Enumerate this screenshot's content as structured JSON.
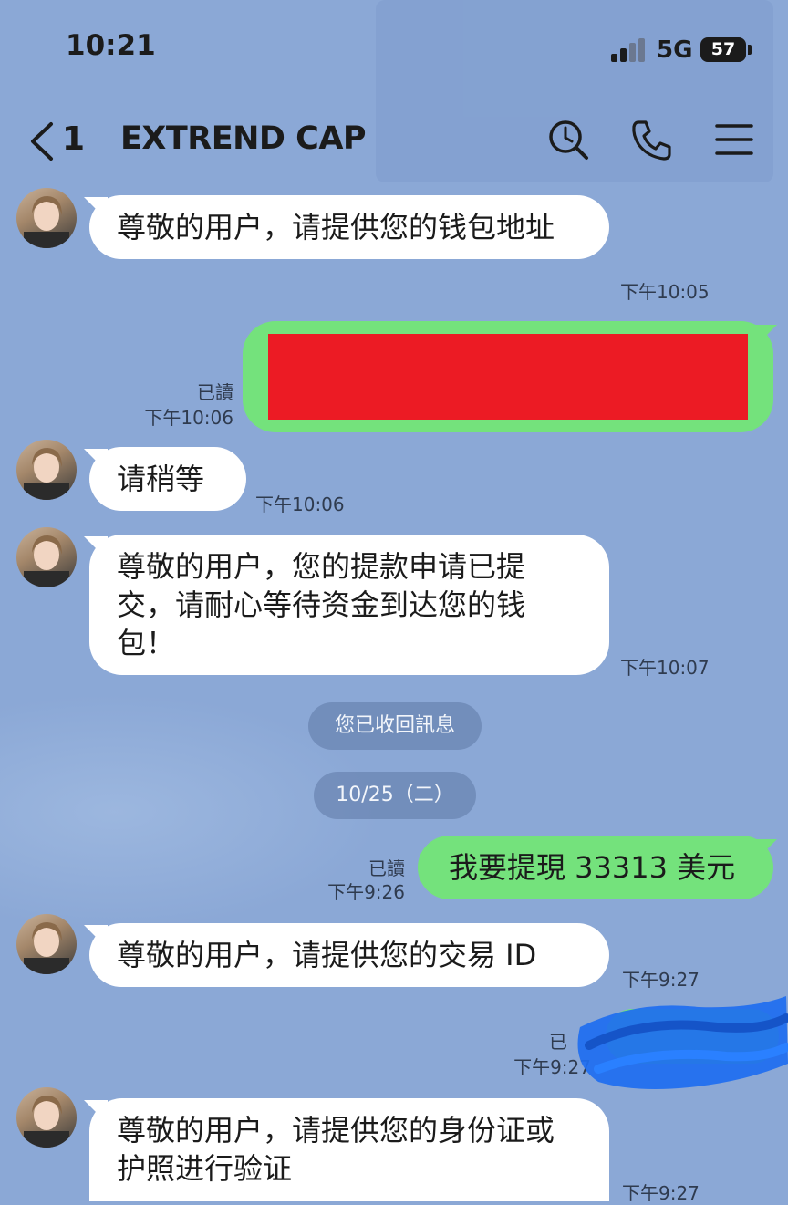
{
  "status_bar": {
    "time": "10:21",
    "network": "5G",
    "battery": "57"
  },
  "header": {
    "back_count": "1",
    "title": "EXTREND CAP"
  },
  "icons": {
    "back": "chevron-left-icon",
    "search": "search-icon",
    "call": "phone-icon",
    "menu": "menu-icon",
    "avatar": "avatar"
  },
  "colors": {
    "background": "#8ba8d6",
    "outgoing_bubble": "#74e27c",
    "incoming_bubble": "#ffffff",
    "redaction": "#ec1b24",
    "scribble": "#1e6ef0"
  },
  "messages": [
    {
      "side": "in",
      "text": "尊敬的用户，请提供您的钱包地址",
      "time": "下午10:05"
    },
    {
      "side": "out",
      "read": "已讀",
      "time": "下午10:06",
      "redacted": true
    },
    {
      "side": "in",
      "text": "请稍等",
      "time": "下午10:06"
    },
    {
      "side": "in",
      "text": "尊敬的用户，您的提款申请已提交，请耐心等待资金到达您的钱包！",
      "time": "下午10:07"
    },
    {
      "side": "system",
      "text": "您已收回訊息"
    },
    {
      "side": "date",
      "text": "10/25（二）"
    },
    {
      "side": "out",
      "read": "已讀",
      "time": "下午9:26",
      "text": "我要提現 33313 美元"
    },
    {
      "side": "in",
      "text": "尊敬的用户，请提供您的交易 ID",
      "time": "下午9:27"
    },
    {
      "side": "out",
      "read": "已",
      "time": "下午9:27",
      "redacted": true
    },
    {
      "side": "in",
      "text": "尊敬的用户，请提供您的身份证或护照进行验证",
      "time": "下午9:27"
    }
  ]
}
